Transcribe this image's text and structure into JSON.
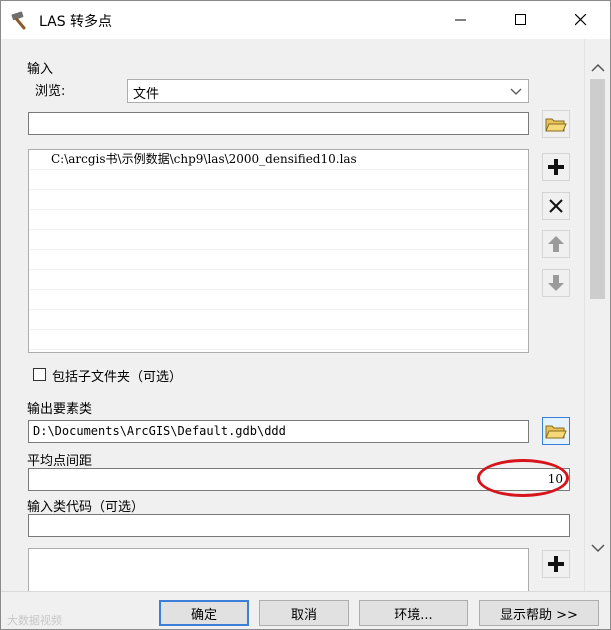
{
  "window": {
    "title": "LAS 转多点",
    "icon": "hammer-icon"
  },
  "form": {
    "input_label": "输入",
    "browse_label": "浏览:",
    "browse_select_value": "文件",
    "path_input_value": "",
    "file_list": [
      "C:\\arcgis书\\示例数据\\chp9\\las\\2000_densified10.las"
    ],
    "include_subfolders_label": "包括子文件夹（可选）",
    "include_subfolders_checked": false,
    "output_label": "输出要素类",
    "output_value": "D:\\Documents\\ArcGIS\\Default.gdb\\ddd",
    "avg_spacing_label": "平均点间距",
    "avg_spacing_value": "10",
    "class_codes_label": "输入类代码（可选）",
    "class_codes_value": ""
  },
  "buttons": {
    "ok": "确定",
    "cancel": "取消",
    "env": "环境...",
    "help": "显示帮助 >>"
  },
  "watermark": "大数据视频"
}
